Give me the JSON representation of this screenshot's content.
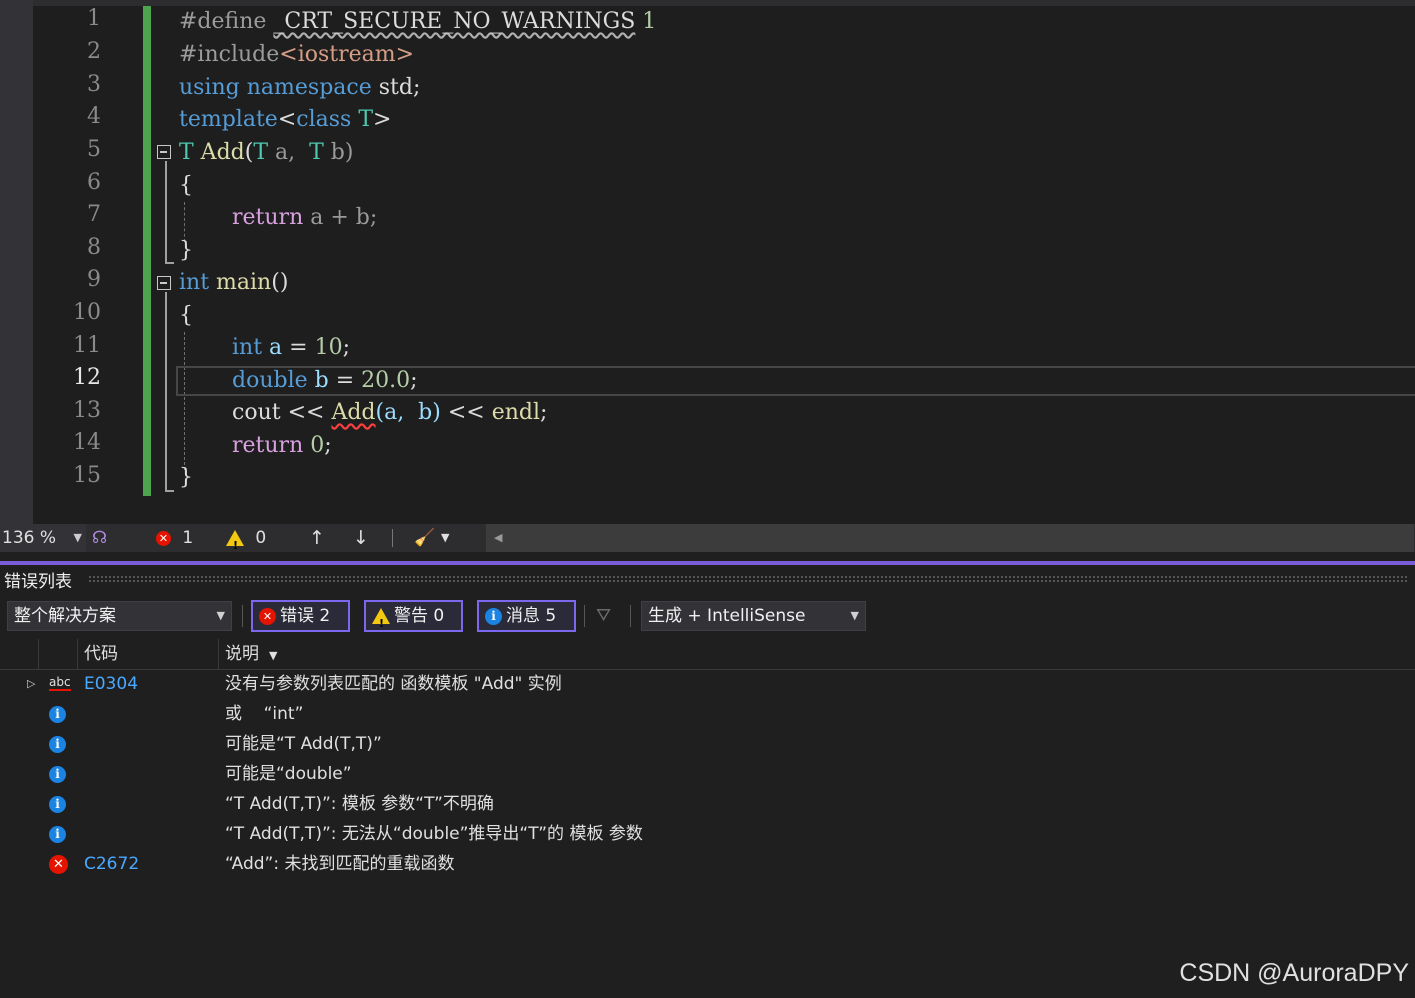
{
  "editor": {
    "line_numbers": [
      "1",
      "2",
      "3",
      "4",
      "5",
      "6",
      "7",
      "8",
      "9",
      "10",
      "11",
      "12",
      "13",
      "14",
      "15"
    ],
    "active_line": "12",
    "code": {
      "l1_a": "#define ",
      "l1_b": "_CRT_SECURE_NO_WARNINGS",
      "l1_c": " 1",
      "l2_a": "#include",
      "l2_b": "<iostream>",
      "l3_a": "using",
      "l3_b": " namespace",
      "l3_c": " std;",
      "l4_a": "template",
      "l4_b": "<",
      "l4_c": "class",
      "l4_d": " T",
      "l4_e": ">",
      "l5_a": "T",
      "l5_b": " Add",
      "l5_c": "(",
      "l5_d": "T",
      "l5_e": " a,  ",
      "l5_f": "T",
      "l5_g": " b)",
      "l6": "{",
      "l7_a": "return",
      "l7_b": " a + b;",
      "l8": "}",
      "l9_a": "int",
      "l9_b": " main",
      "l9_c": "()",
      "l10": "{",
      "l11_a": "int",
      "l11_b": " a",
      "l11_c": " = ",
      "l11_d": "10",
      "l11_e": ";",
      "l12_a": "double",
      "l12_b": " b",
      "l12_c": " = ",
      "l12_d": "20.0",
      "l12_e": ";",
      "l13_a": "cout",
      "l13_b": " << ",
      "l13_c": "Add",
      "l13_d": "(a,  b)",
      "l13_e": " << ",
      "l13_f": "endl",
      "l13_g": ";",
      "l14_a": "return",
      "l14_b": " 0",
      "l14_c": ";",
      "l15": "}"
    }
  },
  "editor_status": {
    "zoom": "136 %",
    "error_count": "1",
    "warning_count": "0"
  },
  "error_list": {
    "title": "错误列表",
    "scope": "整个解决方案",
    "errors_btn": "错误 2",
    "warnings_btn": "警告 0",
    "messages_btn": "消息 5",
    "source": "生成 + IntelliSense",
    "col_code": "代码",
    "col_desc": "说明",
    "rows": [
      {
        "code": "E0304",
        "desc": "没有与参数列表匹配的 函数模板 \"Add\" 实例"
      },
      {
        "code": "",
        "desc": "或    “int”"
      },
      {
        "code": "",
        "desc": "可能是“T Add(T,T)”"
      },
      {
        "code": "",
        "desc": "可能是“double”"
      },
      {
        "code": "",
        "desc": "“T Add(T,T)”: 模板 参数“T”不明确"
      },
      {
        "code": "",
        "desc": "“T Add(T,T)”: 无法从“double”推导出“T”的 模板 参数"
      },
      {
        "code": "C2672",
        "desc": "“Add”: 未找到匹配的重载函数"
      }
    ]
  },
  "watermark": "CSDN @AuroraDPY",
  "colors": {
    "accent": "#7b68ee",
    "error": "#e51400",
    "info": "#1b84e3",
    "warning": "#f2c811",
    "change_bar": "#4ea34e"
  }
}
